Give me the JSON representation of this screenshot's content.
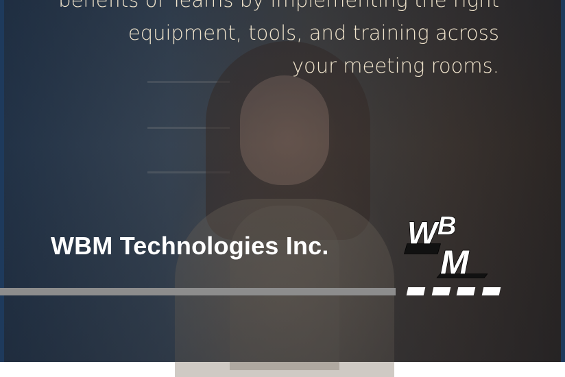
{
  "message": {
    "line1": "benefits of Teams by implementing the right",
    "line2": "equipment, tools, and training across",
    "line3": "your meeting rooms."
  },
  "company": {
    "name": "WBM Technologies Inc."
  },
  "logo": {
    "text": "WBM",
    "icon": "wbm-logo-icon"
  },
  "colors": {
    "text_cream": "#f0e4cc",
    "stripe": "#8d8d8d",
    "white": "#ffffff"
  }
}
